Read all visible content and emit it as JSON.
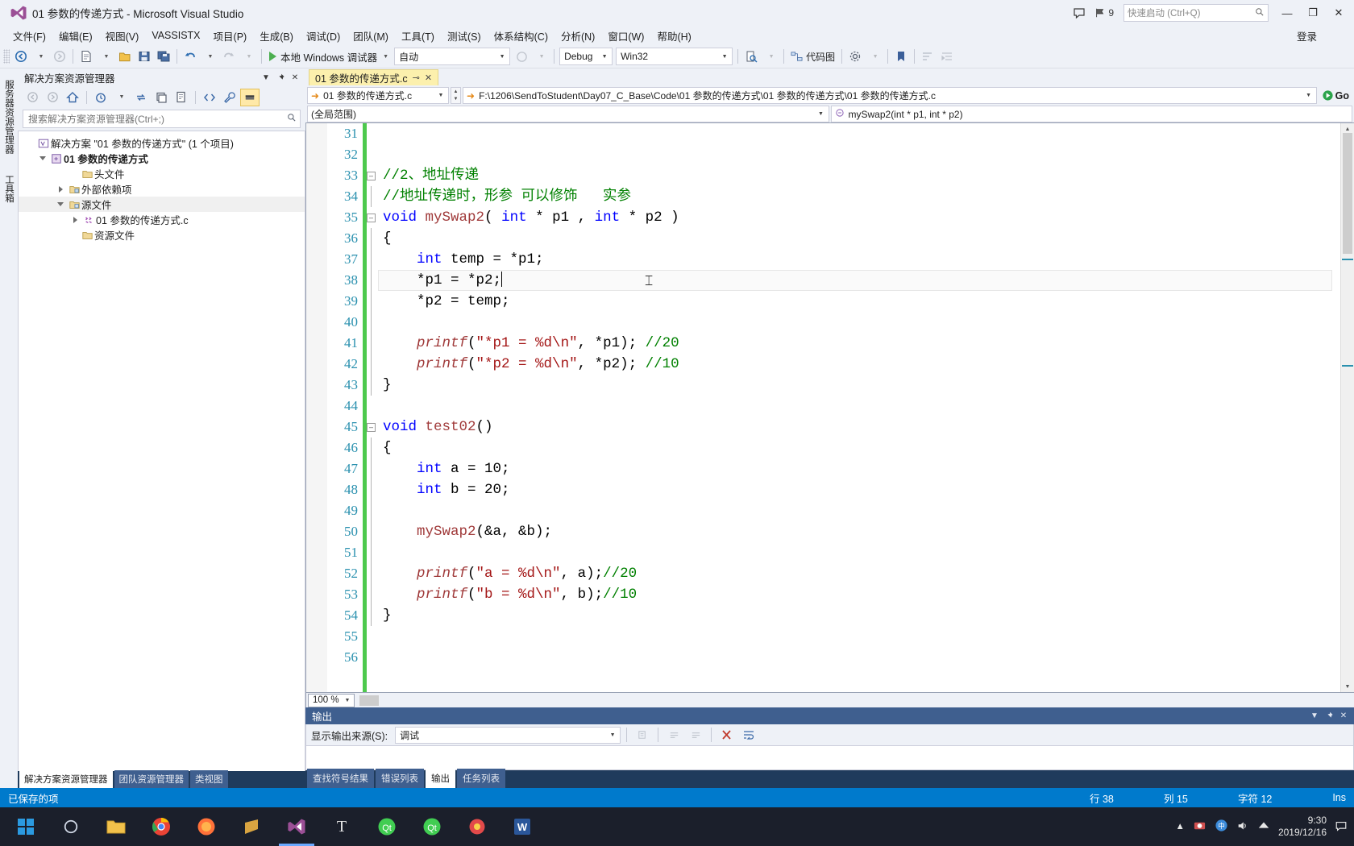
{
  "window": {
    "title": "01 参数的传递方式 - Microsoft Visual Studio",
    "logo_icon": "visual-studio-logo",
    "feedback_icon": "feedback-icon",
    "notify_icon": "notification-flag-icon",
    "notify_count": "9",
    "quick_launch_placeholder": "快速启动 (Ctrl+Q)",
    "search_icon": "search-icon",
    "minimize": "—",
    "maximize": "❐",
    "close": "✕",
    "signin": "登录"
  },
  "menubar": {
    "items": [
      "文件(F)",
      "编辑(E)",
      "视图(V)",
      "VASSISTX",
      "项目(P)",
      "生成(B)",
      "调试(D)",
      "团队(M)",
      "工具(T)",
      "测试(S)",
      "体系结构(C)",
      "分析(N)",
      "窗口(W)",
      "帮助(H)"
    ]
  },
  "toolbar": {
    "nav_back_icon": "navigate-back-icon",
    "nav_fwd_icon": "navigate-forward-icon",
    "new_item_icon": "new-item-icon",
    "open_icon": "open-file-icon",
    "save_icon": "save-icon",
    "save_all_icon": "save-all-icon",
    "undo_icon": "undo-icon",
    "redo_icon": "redo-icon",
    "run_label": "本地 Windows 调试器",
    "run_icon": "play-icon",
    "auto_value": "自动",
    "config_value": "Debug",
    "platform_value": "Win32",
    "attach_icon": "attach-process-icon",
    "codemap_label": "代码图",
    "codemap_icon": "code-map-icon",
    "bookmark_icon": "bookmark-icon",
    "settings_icon": "settings-icon",
    "step_icon": "step-icon",
    "indent_icon": "indent-icon"
  },
  "vstrip": {
    "tabs": [
      "服务器资源管理器",
      "工具箱"
    ]
  },
  "solution_explorer": {
    "title": "解决方案资源管理器",
    "dropdown_icon": "chevron-down-icon",
    "pin_icon": "pin-icon",
    "close_icon": "close-icon",
    "toolbar_icons": [
      "back-icon",
      "forward-icon",
      "home-icon",
      "pending-changes-icon",
      "refresh-icon",
      "collapse-all-icon",
      "show-all-files-icon",
      "view-code-icon",
      "properties-icon",
      "preview-selected-icon"
    ],
    "search_placeholder": "搜索解决方案资源管理器(Ctrl+;)",
    "search_icon": "search-icon",
    "tree": [
      {
        "label": "解决方案 \"01 参数的传递方式\" (1 个项目)",
        "icon": "solution-icon",
        "indent": 0,
        "twisty": "none",
        "bold": false
      },
      {
        "label": "01 参数的传递方式",
        "icon": "cpp-project-icon",
        "indent": 1,
        "twisty": "open",
        "bold": true
      },
      {
        "label": "头文件",
        "icon": "folder-icon",
        "indent": 2,
        "twisty": "none",
        "bold": false
      },
      {
        "label": "外部依赖项",
        "icon": "folder-dep-icon",
        "indent": 2,
        "twisty": "closed",
        "bold": false
      },
      {
        "label": "源文件",
        "icon": "folder-icon",
        "indent": 2,
        "twisty": "open",
        "bold": false,
        "selected": true
      },
      {
        "label": "01 参数的传递方式.c",
        "icon": "c-file-icon",
        "indent": 3,
        "twisty": "closed",
        "bold": false
      },
      {
        "label": "资源文件",
        "icon": "folder-icon",
        "indent": 2,
        "twisty": "none",
        "bold": false
      }
    ],
    "bottom_tabs": [
      {
        "label": "解决方案资源管理器",
        "active": true
      },
      {
        "label": "团队资源管理器",
        "active": false
      },
      {
        "label": "类视图",
        "active": false
      }
    ]
  },
  "editor": {
    "tab": {
      "label": "01 参数的传递方式.c",
      "pin_icon": "pin-icon",
      "close_icon": "close-icon"
    },
    "nav": {
      "project_value": "01 参数的传递方式.c",
      "project_icon": "goto-arrow-icon",
      "path_value": "F:\\1206\\SendToStudent\\Day07_C_Base\\Code\\01 参数的传递方式\\01 参数的传递方式\\01 参数的传递方式.c",
      "path_icon": "goto-arrow-icon",
      "go_label": "Go",
      "go_icon": "vassist-go-icon",
      "scope_value": "(全局范围)",
      "member_value": "mySwap2(int * p1, int * p2)",
      "member_icon": "method-icon"
    },
    "first_line": 31,
    "zoom": "100 %",
    "lines": [
      {
        "n": 31,
        "tokens": []
      },
      {
        "n": 32,
        "tokens": []
      },
      {
        "n": 33,
        "fold": "open",
        "tokens": [
          {
            "t": "//2、地址传递",
            "c": "cm"
          }
        ]
      },
      {
        "n": 34,
        "tokens": [
          {
            "t": "//地址传递时，形参 可以修饰   实参",
            "c": "cm"
          }
        ]
      },
      {
        "n": 35,
        "fold": "open",
        "tokens": [
          {
            "t": "void",
            "c": "kw"
          },
          {
            "t": " ",
            "c": ""
          },
          {
            "t": "mySwap2",
            "c": "fn"
          },
          {
            "t": "( ",
            "c": ""
          },
          {
            "t": "int",
            "c": "kw"
          },
          {
            "t": " * p1 , ",
            "c": ""
          },
          {
            "t": "int",
            "c": "kw"
          },
          {
            "t": " * p2 )",
            "c": ""
          }
        ]
      },
      {
        "n": 36,
        "tokens": [
          {
            "t": "{",
            "c": ""
          }
        ]
      },
      {
        "n": 37,
        "tokens": [
          {
            "t": "    ",
            "c": ""
          },
          {
            "t": "int",
            "c": "kw"
          },
          {
            "t": " temp = *p1;",
            "c": ""
          }
        ]
      },
      {
        "n": 38,
        "current": true,
        "tokens": [
          {
            "t": "    *p1 = *p2;",
            "c": ""
          }
        ]
      },
      {
        "n": 39,
        "tokens": [
          {
            "t": "    *p2 = temp;",
            "c": ""
          }
        ]
      },
      {
        "n": 40,
        "tokens": []
      },
      {
        "n": 41,
        "tokens": [
          {
            "t": "    ",
            "c": ""
          },
          {
            "t": "printf",
            "c": "fn it"
          },
          {
            "t": "(",
            "c": ""
          },
          {
            "t": "\"*p1 = %d\\n\"",
            "c": "str"
          },
          {
            "t": ", *p1); ",
            "c": ""
          },
          {
            "t": "//20",
            "c": "cm"
          }
        ]
      },
      {
        "n": 42,
        "tokens": [
          {
            "t": "    ",
            "c": ""
          },
          {
            "t": "printf",
            "c": "fn it"
          },
          {
            "t": "(",
            "c": ""
          },
          {
            "t": "\"*p2 = %d\\n\"",
            "c": "str"
          },
          {
            "t": ", *p2); ",
            "c": ""
          },
          {
            "t": "//10",
            "c": "cm"
          }
        ]
      },
      {
        "n": 43,
        "tokens": [
          {
            "t": "}",
            "c": ""
          }
        ]
      },
      {
        "n": 44,
        "tokens": []
      },
      {
        "n": 45,
        "fold": "open",
        "tokens": [
          {
            "t": "void",
            "c": "kw"
          },
          {
            "t": " ",
            "c": ""
          },
          {
            "t": "test02",
            "c": "fn"
          },
          {
            "t": "()",
            "c": ""
          }
        ]
      },
      {
        "n": 46,
        "tokens": [
          {
            "t": "{",
            "c": ""
          }
        ]
      },
      {
        "n": 47,
        "tokens": [
          {
            "t": "    ",
            "c": ""
          },
          {
            "t": "int",
            "c": "kw"
          },
          {
            "t": " a = 10;",
            "c": ""
          }
        ]
      },
      {
        "n": 48,
        "tokens": [
          {
            "t": "    ",
            "c": ""
          },
          {
            "t": "int",
            "c": "kw"
          },
          {
            "t": " b = 20;",
            "c": ""
          }
        ]
      },
      {
        "n": 49,
        "tokens": []
      },
      {
        "n": 50,
        "tokens": [
          {
            "t": "    ",
            "c": ""
          },
          {
            "t": "mySwap2",
            "c": "fn"
          },
          {
            "t": "(&a, &b);",
            "c": ""
          }
        ]
      },
      {
        "n": 51,
        "tokens": []
      },
      {
        "n": 52,
        "tokens": [
          {
            "t": "    ",
            "c": ""
          },
          {
            "t": "printf",
            "c": "fn it"
          },
          {
            "t": "(",
            "c": ""
          },
          {
            "t": "\"a = %d\\n\"",
            "c": "str"
          },
          {
            "t": ", a);",
            "c": ""
          },
          {
            "t": "//20",
            "c": "cm"
          }
        ]
      },
      {
        "n": 53,
        "tokens": [
          {
            "t": "    ",
            "c": ""
          },
          {
            "t": "printf",
            "c": "fn it"
          },
          {
            "t": "(",
            "c": ""
          },
          {
            "t": "\"b = %d\\n\"",
            "c": "str"
          },
          {
            "t": ", b);",
            "c": ""
          },
          {
            "t": "//10",
            "c": "cm"
          }
        ]
      },
      {
        "n": 54,
        "tokens": [
          {
            "t": "}",
            "c": ""
          }
        ]
      },
      {
        "n": 55,
        "tokens": []
      },
      {
        "n": 56,
        "tokens": []
      }
    ]
  },
  "output_pane": {
    "title": "输出",
    "dropdown_icon": "chevron-down-icon",
    "pin_icon": "pin-icon",
    "close_icon": "close-icon",
    "source_label": "显示输出来源(S):",
    "source_value": "调试",
    "toolbar_icons": [
      "find-message-icon",
      "clear-all-icon",
      "go-to-previous-icon",
      "go-to-next-icon",
      "toggle-wordwrap-icon",
      "show-output-icon"
    ],
    "tabs": [
      {
        "label": "查找符号结果",
        "active": false
      },
      {
        "label": "错误列表",
        "active": false
      },
      {
        "label": "输出",
        "active": true
      },
      {
        "label": "任务列表",
        "active": false
      }
    ]
  },
  "statusbar": {
    "message": "已保存的项",
    "line": "行 38",
    "column": "列 15",
    "char": "字符 12",
    "insert_mode": "Ins"
  },
  "taskbar": {
    "start_icon": "windows-start-icon",
    "items": [
      {
        "name": "search-cortana-icon",
        "color": "#2f3a4f",
        "glyph": "◯"
      },
      {
        "name": "file-explorer-icon",
        "color": "#f5bf42",
        "glyph": "📁"
      },
      {
        "name": "chrome-icon",
        "color": "#34a853",
        "glyph": "◉"
      },
      {
        "name": "firefox-icon",
        "color": "#ff7139",
        "glyph": "◉"
      },
      {
        "name": "sublime-icon",
        "color": "#d9a441",
        "glyph": "S"
      },
      {
        "name": "visual-studio-icon",
        "color": "#68217a",
        "glyph": "X",
        "active": true
      },
      {
        "name": "typora-icon",
        "color": "#4a4a4a",
        "glyph": "T"
      },
      {
        "name": "qt-creator-icon",
        "color": "#41cd52",
        "glyph": "Qt"
      },
      {
        "name": "qt-designer-icon",
        "color": "#41cd52",
        "glyph": "Qt"
      },
      {
        "name": "xmind-icon",
        "color": "#e24a4a",
        "glyph": "◍"
      },
      {
        "name": "word-icon",
        "color": "#2b579a",
        "glyph": "W"
      }
    ],
    "tray_icons": [
      "hidden-icons-icon",
      "screenshot-icon",
      "input-method-icon",
      "volume-icon",
      "network-icon"
    ],
    "time": "9:30",
    "date": "2019/12/16",
    "notification_icon": "action-center-icon"
  },
  "colors": {
    "accent": "#007acc",
    "tab_active": "#fcf0ad",
    "panel_header": "#3f5f8f",
    "change_bar": "#4dc94d",
    "keyword": "#0000ff",
    "comment": "#008000",
    "string": "#a31515",
    "function": "#a03a3a",
    "linenumber": "#2b91af"
  }
}
